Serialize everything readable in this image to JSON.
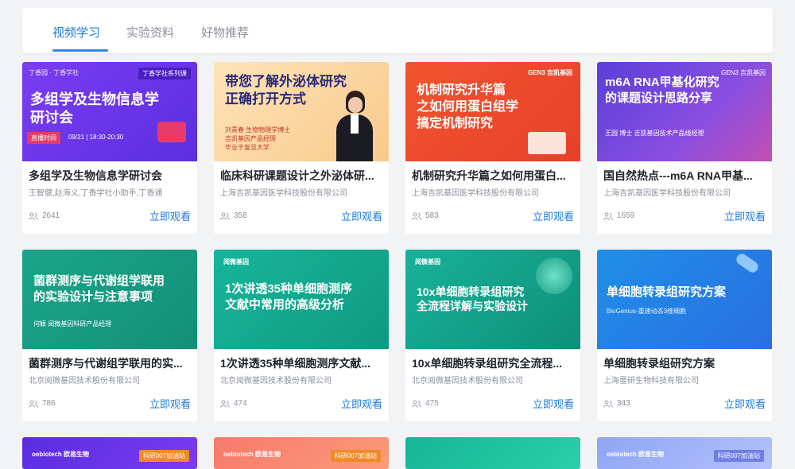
{
  "tabs": [
    {
      "label": "视频学习",
      "active": true
    },
    {
      "label": "实验资料",
      "active": false
    },
    {
      "label": "好物推荐",
      "active": false
    }
  ],
  "accent_color": "#1e7ce0",
  "cards": [
    {
      "title": "多组学及生物信息学研讨会",
      "subtitle": "王智健,赵海义,丁香学社小助手,丁香通",
      "views": "2641",
      "watch": "立即观看",
      "thumb": {
        "top_left": "丁香园 · 丁香学社",
        "badge": "丁香学社系列课",
        "main": "多组学及生物信息学\n研讨会",
        "live_label": "直播时间",
        "live_time": "09/21 | 18:30-20:30"
      }
    },
    {
      "title": "临床科研课题设计之外泌体研...",
      "subtitle": "上海吉凯基因医学科技股份有限公司",
      "views": "358",
      "watch": "立即观看",
      "thumb": {
        "main": "带您了解外泌体研究\n正确打开方式",
        "small": "刘青春 生物物理学博士\n吉凯基因产品经理\n毕业于复旦大学"
      }
    },
    {
      "title": "机制研究升华篇之如何用蛋白...",
      "subtitle": "上海吉凯基因医学科技股份有限公司",
      "views": "583",
      "watch": "立即观看",
      "thumb": {
        "badge": "GEN3 吉凯基因",
        "main": "机制研究升华篇\n之如何用蛋白组学\n搞定机制研究"
      }
    },
    {
      "title": "国自然热点---m6A RNA甲基...",
      "subtitle": "上海吉凯基因医学科技股份有限公司",
      "views": "1659",
      "watch": "立即观看",
      "thumb": {
        "badge": "GEN3 吉凯基因",
        "main": "m6A RNA甲基化研究\n的课题设计思路分享",
        "small": "王园 博士 吉凯基因技术产品线经理"
      }
    },
    {
      "title": "菌群测序与代谢组学联用的实...",
      "subtitle": "北京阅微基因技术股份有限公司",
      "views": "786",
      "watch": "立即观看",
      "thumb": {
        "main": "菌群测序与代谢组学联用\n的实验设计与注意事项",
        "small": "何颖 阅微基因科研产品经理"
      }
    },
    {
      "title": "1次讲透35种单细胞测序文献...",
      "subtitle": "北京阅微基因技术股份有限公司",
      "views": "474",
      "watch": "立即观看",
      "thumb": {
        "logo": "阅微基因",
        "main": "1次讲透35种单细胞测序\n文献中常用的高级分析"
      }
    },
    {
      "title": "10x单细胞转录组研究全流程...",
      "subtitle": "北京阅微基因技术股份有限公司",
      "views": "475",
      "watch": "立即观看",
      "thumb": {
        "logo": "阅微基因",
        "main": "10x单细胞转录组研究\n全流程详解与实验设计"
      }
    },
    {
      "title": "单细胞转录组研究方案",
      "subtitle": "上海噩研生物科技有限公司",
      "views": "343",
      "watch": "立即观看",
      "thumb": {
        "main": "单细胞转录组研究方案",
        "small": "BioGenius-重建动态3维细胞"
      }
    }
  ],
  "bottom_row": [
    {
      "logo": "oebiotech 欧易生物",
      "badge": "科研007加油站"
    },
    {
      "logo": "oebiotech 欧易生物",
      "badge": "科研007加油站"
    },
    {},
    {
      "logo": "oebiotech 欧易生物",
      "badge": "科研007加油站"
    }
  ]
}
